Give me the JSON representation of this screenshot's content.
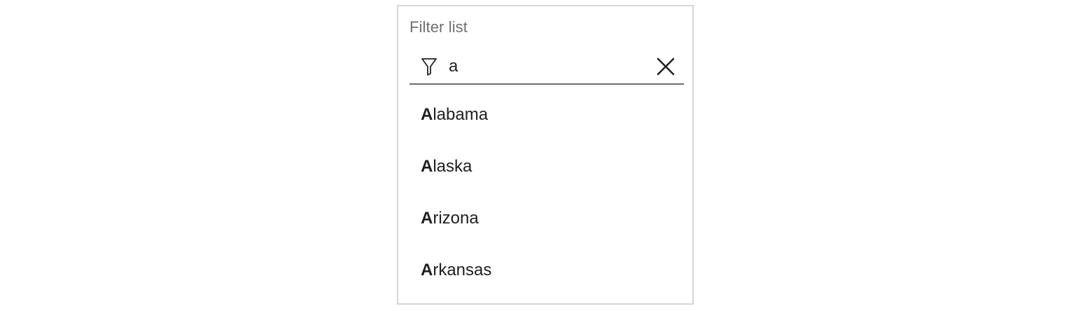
{
  "filter_panel": {
    "title": "Filter list",
    "search": {
      "value": "a",
      "icon": "filter-icon",
      "clear_icon": "close-icon"
    },
    "results": [
      {
        "match": "A",
        "rest": "labama"
      },
      {
        "match": "A",
        "rest": "laska"
      },
      {
        "match": "A",
        "rest": "rizona"
      },
      {
        "match": "A",
        "rest": "rkansas"
      }
    ]
  }
}
